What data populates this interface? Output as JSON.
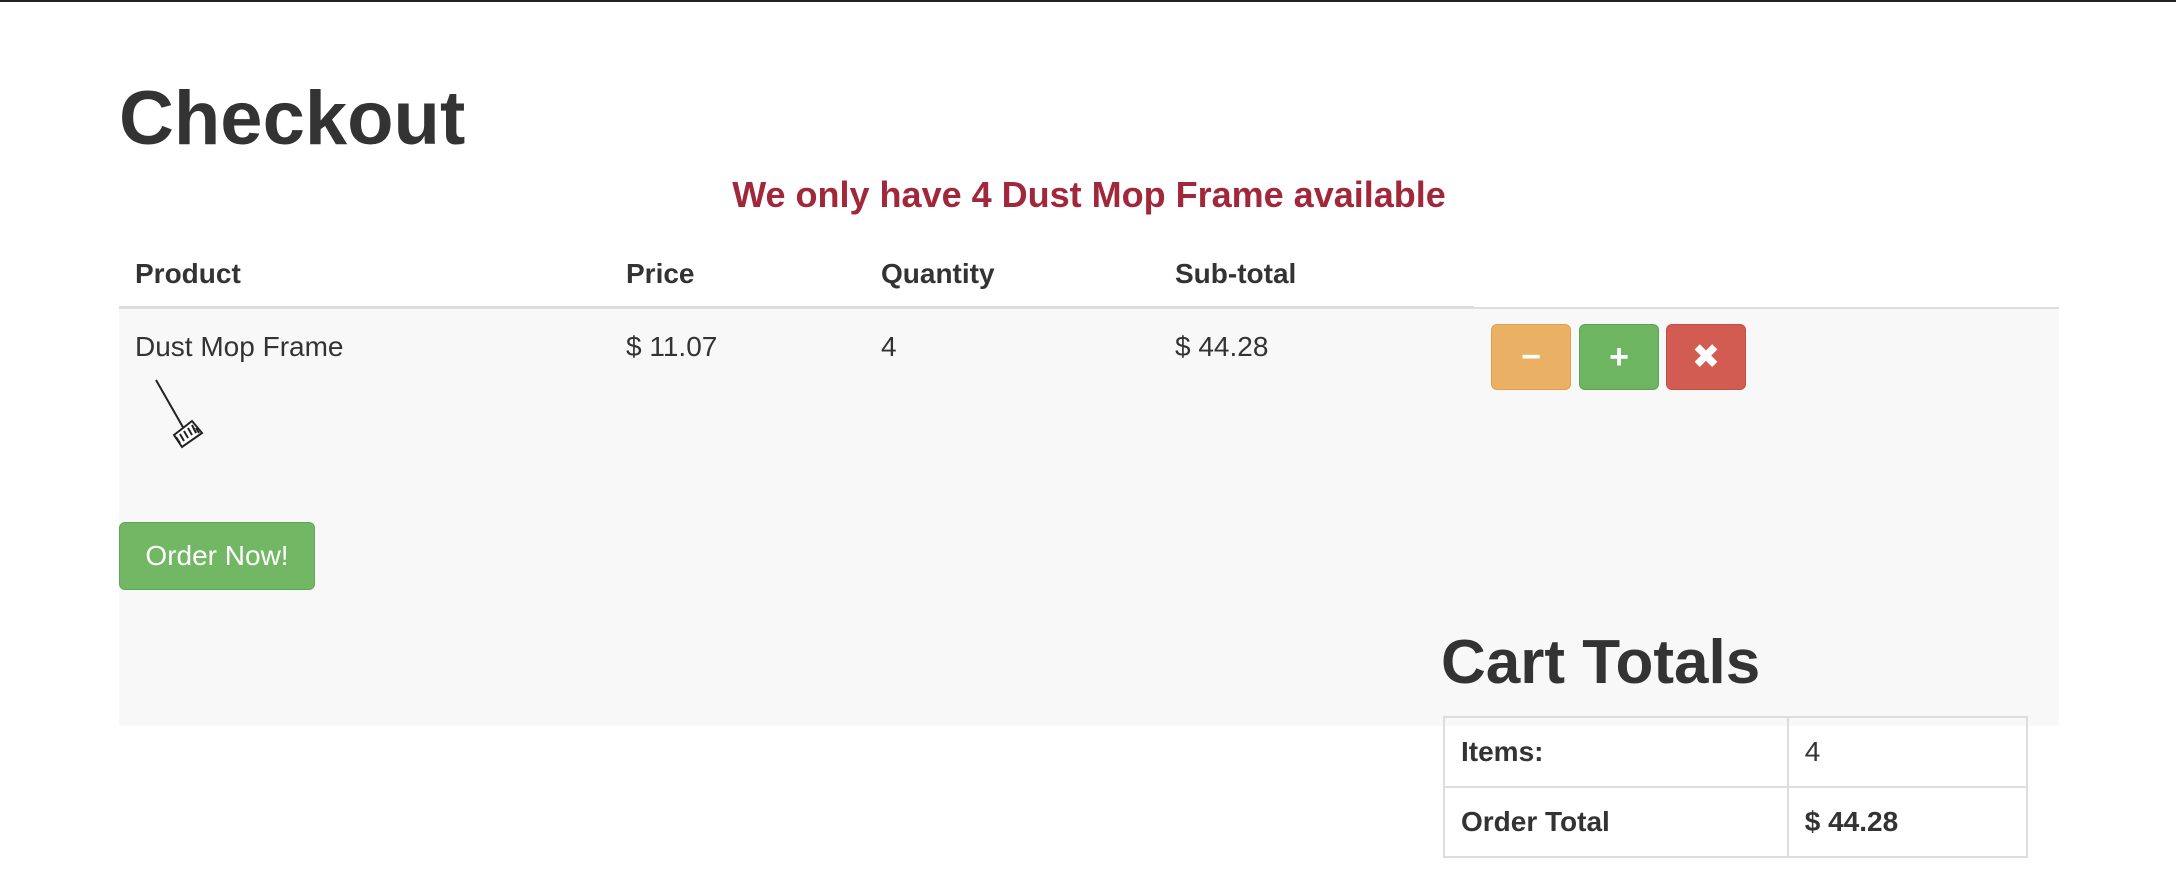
{
  "page": {
    "title": "Checkout",
    "stock_message": "We only have 4 Dust Mop Frame available"
  },
  "cart": {
    "headers": {
      "product": "Product",
      "price": "Price",
      "quantity": "Quantity",
      "subtotal": "Sub-total"
    },
    "items": [
      {
        "product": "Dust Mop Frame",
        "price": "$ 11.07",
        "quantity": "4",
        "subtotal": "$ 44.28",
        "image_icon": "broom-icon"
      }
    ],
    "buttons": {
      "decrease": "−",
      "increase": "+",
      "remove": "✖"
    },
    "order_button": "Order Now!"
  },
  "totals": {
    "title": "Cart Totals",
    "items_label": "Items:",
    "items_value": "4",
    "order_total_label": "Order Total",
    "order_total_value": "$ 44.28"
  },
  "colors": {
    "warning_text": "#a0283a",
    "btn_warning": "#eab164",
    "btn_success": "#6db560",
    "btn_danger": "#d35c52"
  }
}
